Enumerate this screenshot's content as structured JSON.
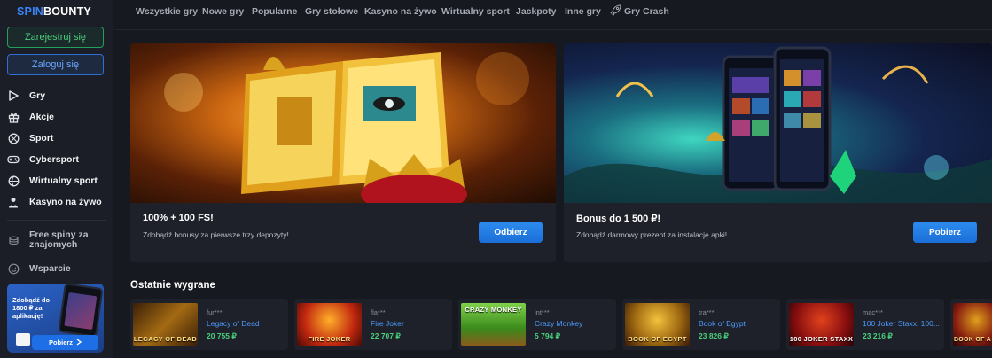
{
  "logo": {
    "part1": "SPIN",
    "part2": "BOUNTY"
  },
  "auth": {
    "register": "Zarejestruj się",
    "login": "Zaloguj się"
  },
  "sidebar": {
    "items": [
      {
        "label": "Gry",
        "icon": "play-icon"
      },
      {
        "label": "Akcje",
        "icon": "gift-icon"
      },
      {
        "label": "Sport",
        "icon": "ball-icon"
      },
      {
        "label": "Cybersport",
        "icon": "gamepad-icon"
      },
      {
        "label": "Wirtualny sport",
        "icon": "virtual-sport-icon"
      },
      {
        "label": "Kasyno na żywo",
        "icon": "dealer-icon"
      }
    ],
    "secondary": [
      {
        "label": "Free spiny za znajomych",
        "icon": "coins-icon"
      },
      {
        "label": "Wsparcie",
        "icon": "support-icon"
      }
    ],
    "promo": {
      "text": "Zdobądź do 1800 ₽ za aplikację!",
      "button": "Pobierz"
    }
  },
  "topnav": {
    "tabs": [
      "Wszystkie gry",
      "Nowe gry",
      "Popularne",
      "Gry stołowe",
      "Kasyno na żywo",
      "Wirtualny sport",
      "Jackpoty",
      "Inne gry",
      "Gry Crash"
    ]
  },
  "banners": [
    {
      "title": "100% + 100 FS!",
      "subtitle": "Zdobądź bonusy za pierwsze trzy depozyty!",
      "button": "Odbierz"
    },
    {
      "title": "Bonus do 1 500 ₽!",
      "subtitle": "Zdobądź darmowy prezent za instalację apki!",
      "button": "Pobierz"
    }
  ],
  "recent": {
    "title": "Ostatnie wygrane",
    "items": [
      {
        "user": "fur***",
        "game": "Legacy of Dead",
        "amount": "20 755 ₽",
        "thumb_text": "LEGACY OF DEAD"
      },
      {
        "user": "fla***",
        "game": "Fire Joker",
        "amount": "22 707 ₽",
        "thumb_text": "FIRE JOKER"
      },
      {
        "user": "int***",
        "game": "Crazy Monkey",
        "amount": "5 794 ₽",
        "thumb_text": "CRAZY MONKEY"
      },
      {
        "user": "tra***",
        "game": "Book of Egypt",
        "amount": "23 826 ₽",
        "thumb_text": "BOOK OF EGYPT"
      },
      {
        "user": "mac***",
        "game": "100 Joker Staxx: 100...",
        "amount": "23 216 ₽",
        "thumb_text": "100 JOKER STAXX"
      },
      {
        "user": "",
        "game": "",
        "amount": "",
        "thumb_text": "BOOK OF A"
      }
    ]
  },
  "colors": {
    "accent_blue": "#2d8cf0",
    "accent_green": "#4ad07c",
    "background": "#16191f",
    "card": "#1e2129"
  }
}
